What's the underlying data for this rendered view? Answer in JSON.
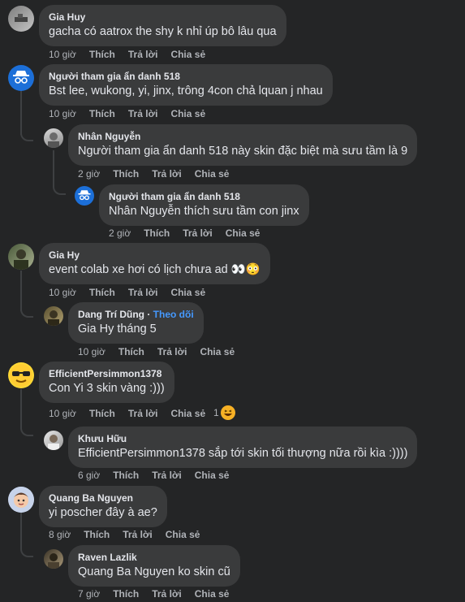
{
  "labels": {
    "like": "Thích",
    "reply": "Trả lời",
    "share": "Chia sẻ",
    "follow": "Theo dõi"
  },
  "comments": [
    {
      "author": "Gia Huy",
      "text": "gacha có aatrox the shy k nhỉ úp bô lâu qua",
      "time": "10 giờ",
      "avatar": "grey-photo-avatar"
    },
    {
      "author": "Người tham gia ẩn danh 518",
      "text": "Bst lee, wukong, yi, jinx, trông 4con chả lquan j nhau",
      "time": "10 giờ",
      "avatar": "anonymous-icon"
    },
    {
      "author": "Nhân Nguyễn",
      "text": "Người tham gia ẩn danh 518 này skin đặc biệt mà sưu tầm là 9",
      "time": "2 giờ",
      "avatar": "photo-avatar"
    },
    {
      "author": "Người tham gia ẩn danh 518",
      "text": "Nhân Nguyễn thích sưu tầm con jinx",
      "time": "2 giờ",
      "avatar": "anonymous-icon"
    },
    {
      "author": "Gia Hy",
      "text": "event colab xe hơi có lịch chưa ad 👀😳",
      "time": "10 giờ",
      "avatar": "photo-avatar"
    },
    {
      "author": "Dang Trí Dũng",
      "text": "Gia Hy tháng 5",
      "time": "10 giờ",
      "avatar": "photo-avatar",
      "follow": true
    },
    {
      "author": "EfficientPersimmon1378",
      "text": "Con Yi 3 skin vàng :)))",
      "time": "10 giờ",
      "avatar": "sunglasses-emoji-avatar",
      "reaction_count": "1"
    },
    {
      "author": "Khưu Hữu",
      "text": "EfficientPersimmon1378 sắp tới skin tối thượng nữa rồi kìa :))))",
      "time": "6 giờ",
      "avatar": "photo-avatar"
    },
    {
      "author": "Quang Ba Nguyen",
      "text": "yi poscher đây à ae?",
      "time": "8 giờ",
      "avatar": "cartoon-avatar"
    },
    {
      "author": "Raven Lazlik",
      "text": "Quang Ba Nguyen ko skin cũ",
      "time": "7 giờ",
      "avatar": "photo-avatar"
    }
  ],
  "colors": {
    "background": "#242526",
    "bubble": "#3a3b3c",
    "muted": "#b0b3b8",
    "link": "#4599ff"
  }
}
